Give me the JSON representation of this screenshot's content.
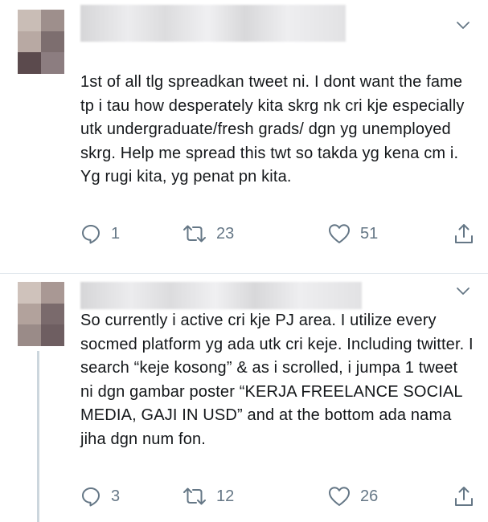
{
  "icons": {
    "reply": "reply-icon",
    "retweet": "retweet-icon",
    "like": "heart-icon",
    "share": "share-icon",
    "menu": "chevron-down-icon"
  },
  "colors": {
    "text": "#14171a",
    "action_gray": "#657786",
    "divider": "#e1e8ed",
    "thread_line": "#ccd6dd"
  },
  "tweets": [
    {
      "text": "1st of all tlg spreadkan tweet ni. I dont want the fame tp i tau how desperately kita skrg nk cri kje especially utk undergraduate/fresh grads/ dgn yg unemployed skrg. Help me spread this twt so takda yg kena cm i. Yg rugi kita, yg penat pn kita.",
      "replies": "1",
      "retweets": "23",
      "likes": "51"
    },
    {
      "text": "So currently i active cri kje PJ area. I utilize every socmed platform yg ada utk cri keje. Including twitter. I search “keje kosong” & as i scrolled, i jumpa 1 tweet ni dgn gambar poster “KERJA FREELANCE SOCIAL MEDIA, GAJI IN USD” and at the bottom ada nama jiha dgn num fon.",
      "replies": "3",
      "retweets": "12",
      "likes": "26"
    }
  ]
}
